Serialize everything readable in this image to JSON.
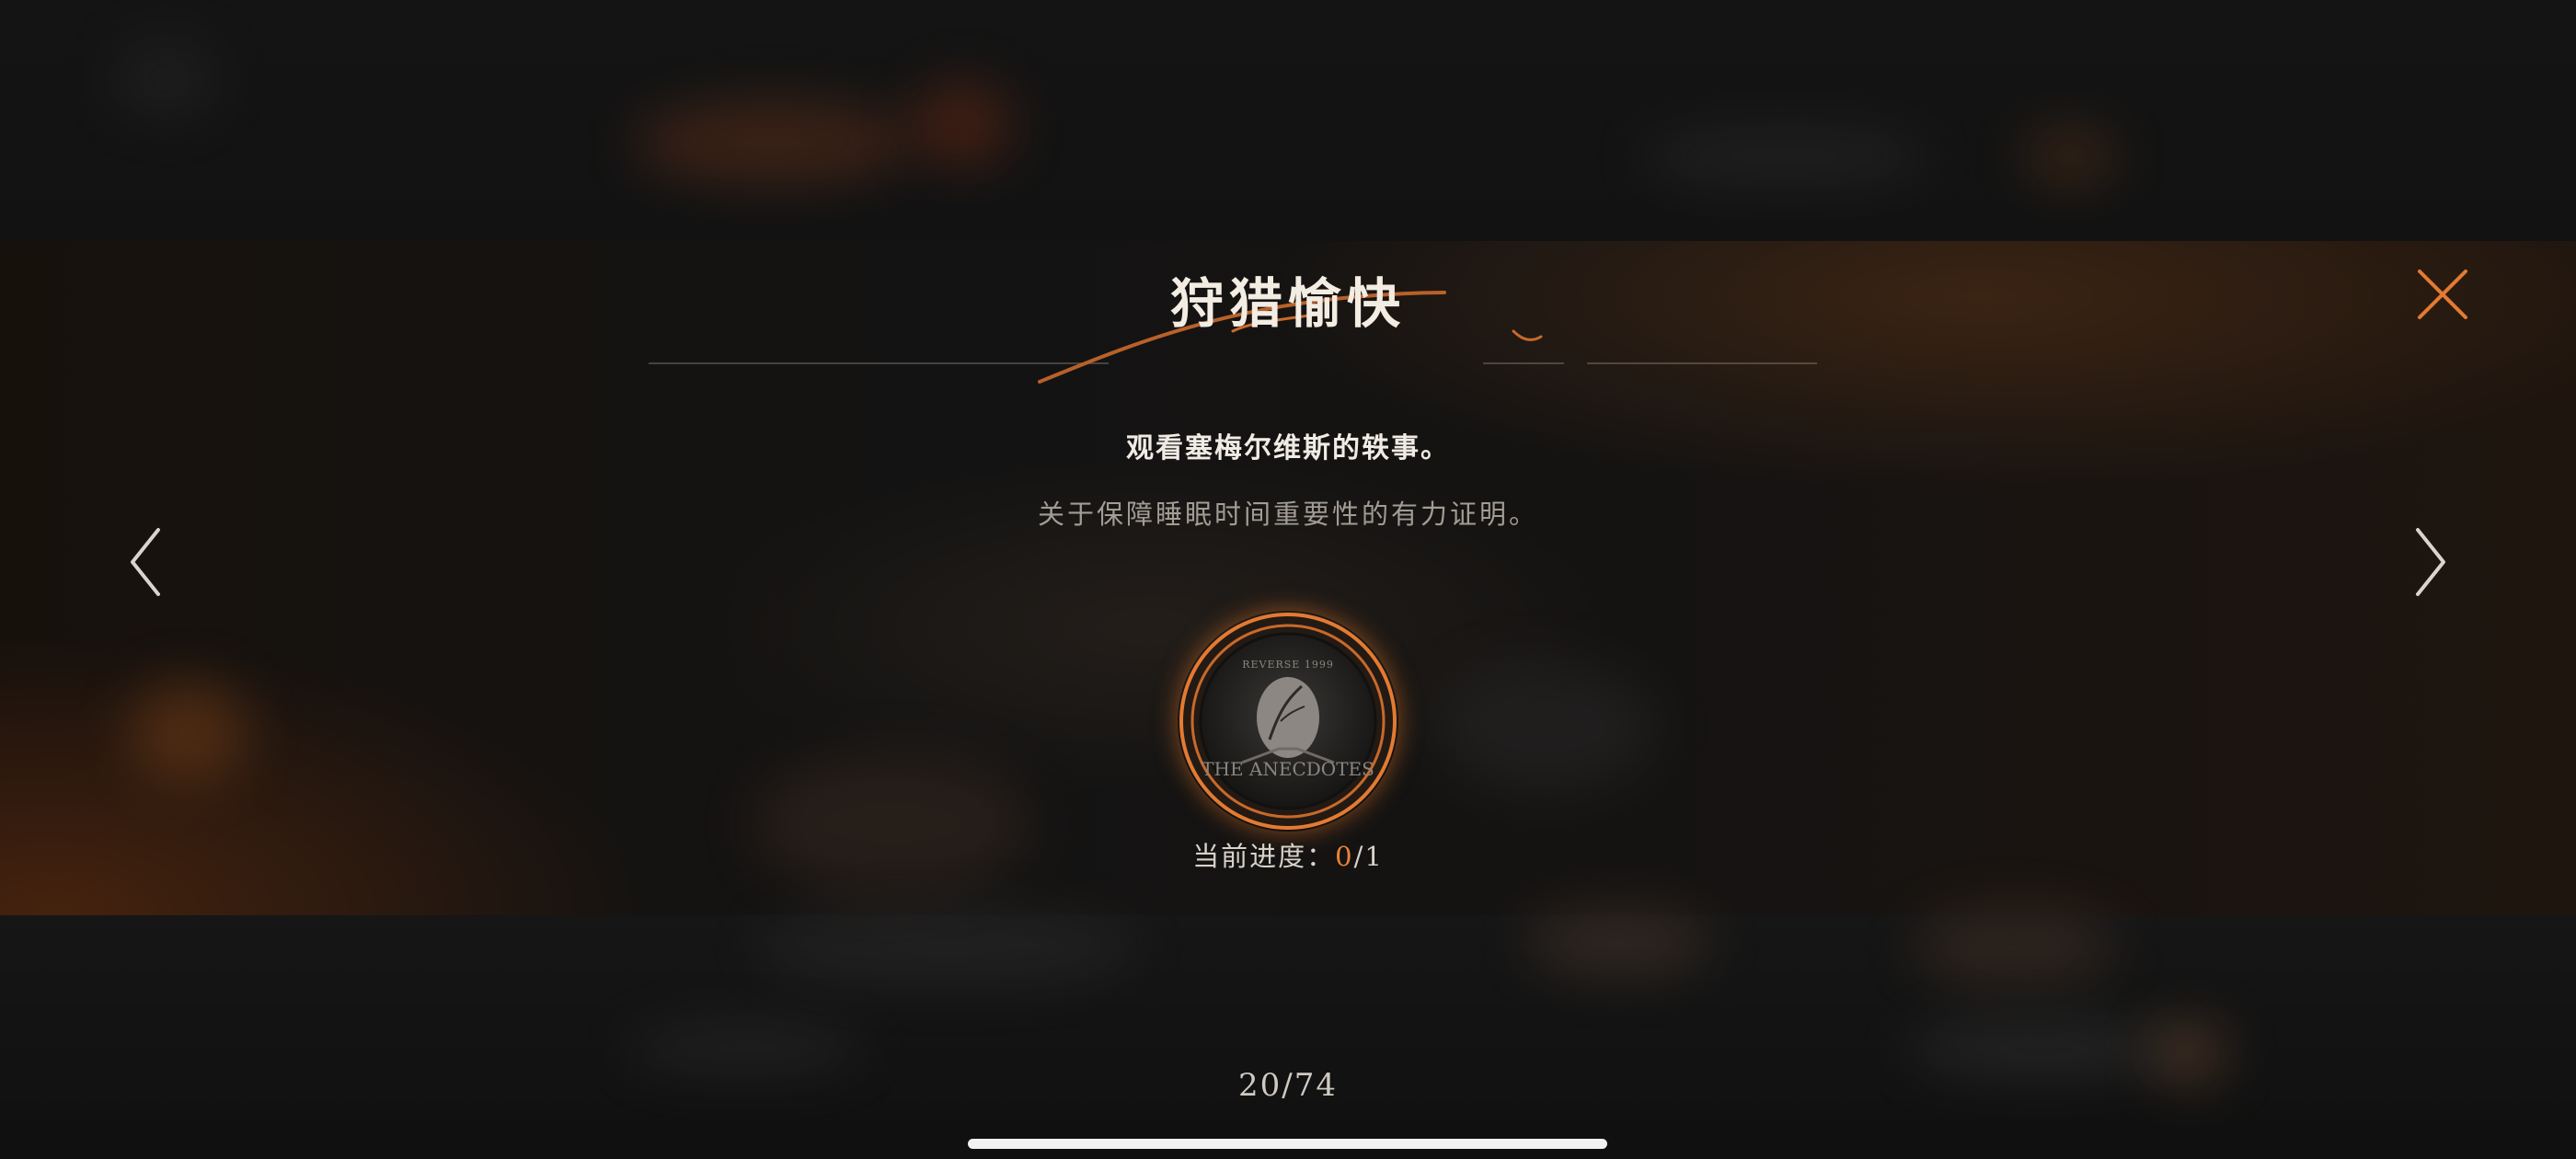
{
  "achievement": {
    "title": "狩猎愉快",
    "description": "观看塞梅尔维斯的轶事。",
    "flavor_text": "关于保障睡眠时间重要性的有力证明。",
    "badge": {
      "top_text": "REVERSE 1999",
      "bottom_text": "THE ANECDOTES"
    },
    "progress": {
      "label": "当前进度：",
      "current": "0",
      "separator": "/",
      "total": "1"
    }
  },
  "pagination": {
    "counter": "20/74"
  },
  "controls": {
    "prev_icon": "chevron-left-icon",
    "next_icon": "chevron-right-icon",
    "close_icon": "close-icon"
  },
  "colors": {
    "accent": "#e8833a",
    "title": "#f3ece2",
    "muted_text": "#a29c94"
  }
}
